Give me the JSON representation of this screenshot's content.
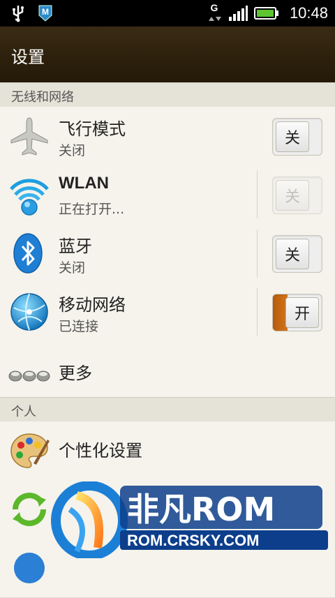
{
  "statusbar": {
    "time": "10:48",
    "network_type": "G"
  },
  "header": {
    "title": "设置"
  },
  "sections": {
    "wireless": "无线和网络",
    "personal": "个人"
  },
  "rows": {
    "airplane": {
      "title": "飞行模式",
      "subtitle": "关闭",
      "toggle": "关",
      "toggle_state": "off"
    },
    "wlan": {
      "title": "WLAN",
      "subtitle": "正在打开...",
      "toggle": "关",
      "toggle_state": "disabled"
    },
    "bluetooth": {
      "title": "蓝牙",
      "subtitle": "关闭",
      "toggle": "关",
      "toggle_state": "off"
    },
    "mobile": {
      "title": "移动网络",
      "subtitle": "已连接",
      "toggle": "开",
      "toggle_state": "on"
    },
    "more": {
      "title": "更多"
    },
    "personalize": {
      "title": "个性化设置"
    }
  },
  "watermark": {
    "brand": "非凡ROM",
    "url": "ROM.CRSKY.COM"
  },
  "colors": {
    "toggle_on": "#d1761a",
    "header_bg": "#2e2210"
  }
}
